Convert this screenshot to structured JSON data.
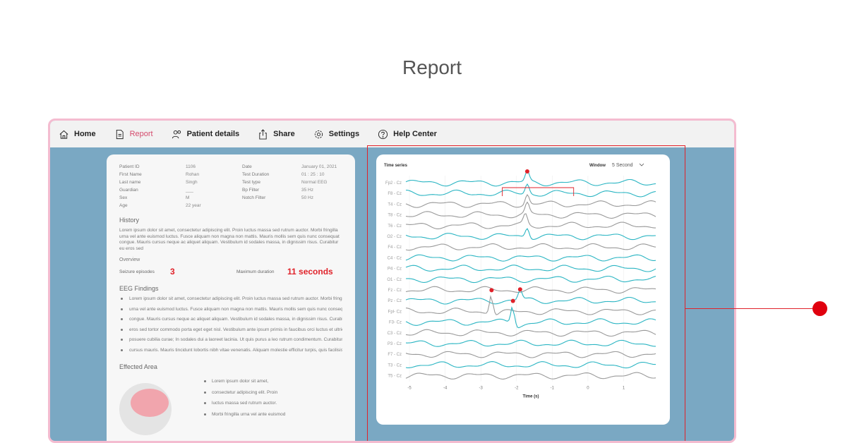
{
  "page_title": "Report",
  "nav": {
    "home": "Home",
    "report": "Report",
    "patient_details": "Patient details",
    "share": "Share",
    "settings": "Settings",
    "help": "Help Center"
  },
  "patient": [
    {
      "l1": "Patient ID",
      "v1": "1106",
      "l2": "Date",
      "v2": "January 01, 2021"
    },
    {
      "l1": "First Name",
      "v1": "Rohan",
      "l2": "Test Duration",
      "v2": "01 : 25 : 10"
    },
    {
      "l1": "Last name",
      "v1": "Singh",
      "l2": "Test type",
      "v2": "Normal EEG"
    },
    {
      "l1": "Guardian",
      "v1": "___",
      "l2": "Bp Filter",
      "v2": "35 Hz"
    },
    {
      "l1": "Sex",
      "v1": "M",
      "l2": "Notch Filter",
      "v2": "50 Hz"
    },
    {
      "l1": "Age",
      "v1": "22 year",
      "l2": "",
      "v2": ""
    }
  ],
  "history": {
    "title": "History",
    "text": "Lorem ipsum dolor sit amet, consectetur adipiscing elit. Proin luctus massa sed rutrum auctor. Morbi fringilla urna vel ante euismod luctus. Fusce aliquam non magna non mattis. Mauris mollis sem quis nunc consequat congue. Mauris cursus neque ac aliquet aliquam. Vestibulum id sodales massa, in dignissim risus. Curabitur eu eros sed"
  },
  "overview": {
    "title": "Overview",
    "seizure_label": "Seizure episodes",
    "seizure_value": "3",
    "duration_label": "Maximum duration",
    "duration_value": "11 seconds"
  },
  "findings": {
    "title": "EEG Findings",
    "items": [
      "Lorem ipsum dolor sit amet, consectetur adipiscing elit. Proin luctus massa sed rutrum auctor. Morbi fringilla",
      "urna vel ante euismod luctus. Fusce aliquam non magna non mattis. Mauris mollis sem quis nunc consequat",
      "congue. Mauris cursus neque ac aliquet aliquam. Vestibulum id sodales massa, in dignissim risus. Curabitur eu",
      "eros sed tortor commodo porta eget eget nisl. Vestibulum ante ipsum primis in faucibus orci luctus et ultrices",
      "posuere cubilia curae; In sodales dui a laoreet lacinia. Ut quis purus a leo rutrum condimentum. Curabitur quis",
      "cursus mauris. Mauris tincidunt lobortis nibh vitae venenatis. Aliquam molestie efficitur turpis, quis facilisis."
    ]
  },
  "affected": {
    "title": "Effected Area",
    "items": [
      "Lorem ipsum dolor sit amet,",
      "consectetur adipiscing elit. Proin",
      "luctus massa sed rutrum auctor.",
      "Morbi fringilla urna vel ante euismod"
    ]
  },
  "chart_data": {
    "type": "line",
    "title": "Time series",
    "window_label": "Window",
    "window_value": "5 Second",
    "xlabel": "Time (s)",
    "x_ticks": [
      -5,
      -4,
      -3,
      -2,
      -1,
      0,
      1
    ],
    "xlim": [
      -5.1,
      1.9
    ],
    "channels": [
      "Fp2 - Cz",
      "F8 - Cz",
      "T4 - Cz",
      "T8 - Cz",
      "T6 - Cz",
      "O2 - Cz",
      "F4 - Cz",
      "C4 - Cz",
      "P4 - Cz",
      "O1 - Cz",
      "Fz - Cz",
      "Pz - Cz",
      "Fpl- Cz",
      "F3- Cz",
      "C3 - Cz",
      "P3 - Cz",
      "F7 - Cz",
      "T3 - Cz",
      "T5 - Cz"
    ],
    "series_colors": [
      "#2bb5c3",
      "#2bb5c3",
      "#999999",
      "#999999",
      "#999999",
      "#2bb5c3",
      "#999999",
      "#2bb5c3",
      "#2bb5c3",
      "#2bb5c3",
      "#999999",
      "#2bb5c3",
      "#999999",
      "#2bb5c3",
      "#999999",
      "#2bb5c3",
      "#999999",
      "#2bb5c3",
      "#999999"
    ],
    "events": [
      {
        "channel": 0,
        "x": -1.7
      },
      {
        "channel": 11,
        "x": -1.9
      },
      {
        "channel": 12,
        "x": -2.7
      },
      {
        "channel": 13,
        "x": -2.1
      }
    ],
    "bracket": {
      "channel": 0,
      "x_start": -2.4,
      "x_end": -0.4
    }
  },
  "colors": {
    "accent": "#e0222a",
    "nav_active": "#d44a6c",
    "frame_border": "#f4bcd0",
    "background": "#7aa8c3"
  }
}
